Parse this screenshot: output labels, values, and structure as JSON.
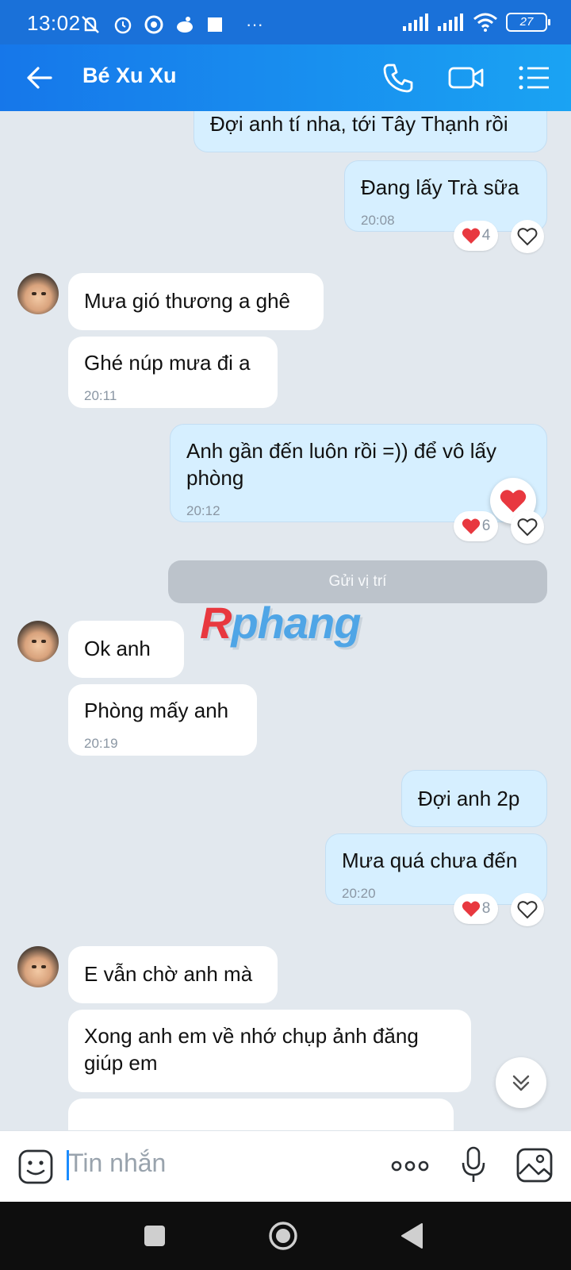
{
  "status_bar": {
    "time": "13:02",
    "battery": "27",
    "more": "···"
  },
  "header": {
    "title": "Bé Xu Xu"
  },
  "messages": [
    {
      "text": "Đợi anh tí nha, tới Tây Thạnh rồi"
    },
    {
      "text": "Đang lấy Trà sữa",
      "time": "20:08",
      "reaction_count": "4"
    },
    {
      "text": "Mưa gió thương a ghê"
    },
    {
      "text": "Ghé núp mưa đi a",
      "time": "20:11"
    },
    {
      "text": "Anh gần đến luôn rồi =)) để vô lấy phòng",
      "time": "20:12",
      "reaction_count": "6"
    },
    {
      "text": "Gửi vị trí"
    },
    {
      "text": "Ok anh"
    },
    {
      "text": "Phòng mấy anh",
      "time": "20:19"
    },
    {
      "text": "Đợi anh 2p"
    },
    {
      "text": "Mưa quá chưa đến",
      "time": "20:20",
      "reaction_count": "8"
    },
    {
      "text": "E vẫn chờ anh mà"
    },
    {
      "text": "Xong anh em về nhớ chụp ảnh đăng giúp em"
    }
  ],
  "watermark": {
    "first": "R",
    "rest": "phang"
  },
  "input": {
    "placeholder": "Tin nhắn"
  },
  "colors": {
    "header": "#1677ea",
    "my_bubble": "#d6efff",
    "heart": "#e8383f"
  }
}
